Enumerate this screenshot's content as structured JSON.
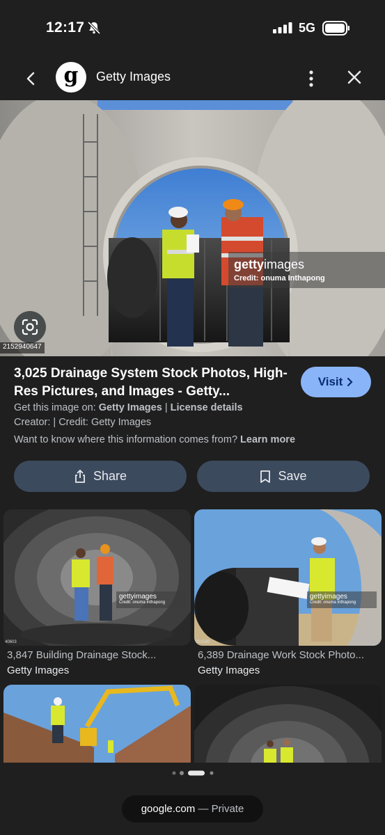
{
  "status_bar": {
    "time": "12:17",
    "network": "5G"
  },
  "header": {
    "title": "Getty Images",
    "logo_letter": "g"
  },
  "hero": {
    "image_id": "2152940647",
    "watermark_logo_a": "getty",
    "watermark_logo_b": "images",
    "watermark_credit": "Credit: onuma Inthapong"
  },
  "result": {
    "title": "3,025 Drainage System Stock Photos, High-Res Pictures, and Images - Getty...",
    "visit_label": "Visit",
    "get_image_prefix": "Get this image on:",
    "get_image_source": "Getty Images",
    "separator": "|",
    "license_label": "License details",
    "creator_line": "Creator: | Credit: Getty Images",
    "info_question": "Want to know where this information comes from?",
    "learn_more": "Learn more"
  },
  "actions": {
    "share": "Share",
    "save": "Save"
  },
  "related": [
    {
      "caption": "3,847 Building Drainage Stock...",
      "source": "Getty Images",
      "id": "40603",
      "wm": "gettyimages",
      "credit": "Credit: onuma Inthapong"
    },
    {
      "caption": "6,389 Drainage Work Stock Photo...",
      "source": "Getty Images",
      "id": "201598",
      "wm": "gettyimages",
      "credit": "Credit: onuma Inthapong"
    }
  ],
  "bottom": {
    "domain": "google.com",
    "separator": "—",
    "mode": "Private"
  }
}
